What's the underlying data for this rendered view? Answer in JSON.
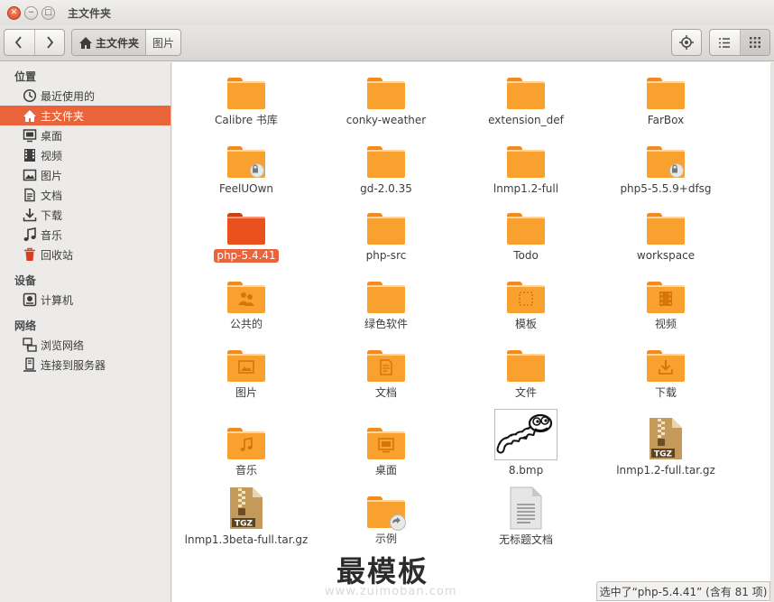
{
  "window": {
    "title": "主文件夹"
  },
  "breadcrumbs": [
    "主文件夹",
    "图片"
  ],
  "sidebar": {
    "sections": [
      {
        "title": "位置",
        "items": [
          {
            "label": "最近使用的",
            "icon": "clock-icon"
          },
          {
            "label": "主文件夹",
            "icon": "home-icon",
            "selected": true
          },
          {
            "label": "桌面",
            "icon": "desktop-icon"
          },
          {
            "label": "视频",
            "icon": "video-icon"
          },
          {
            "label": "图片",
            "icon": "picture-icon"
          },
          {
            "label": "文档",
            "icon": "document-icon"
          },
          {
            "label": "下载",
            "icon": "download-icon"
          },
          {
            "label": "音乐",
            "icon": "music-icon"
          },
          {
            "label": "回收站",
            "icon": "trash-icon"
          }
        ]
      },
      {
        "title": "设备",
        "items": [
          {
            "label": "计算机",
            "icon": "computer-icon"
          }
        ]
      },
      {
        "title": "网络",
        "items": [
          {
            "label": "浏览网络",
            "icon": "network-icon"
          },
          {
            "label": "连接到服务器",
            "icon": "server-icon"
          }
        ]
      }
    ]
  },
  "files": [
    {
      "name": "Calibre 书库",
      "type": "folder"
    },
    {
      "name": "conky-weather",
      "type": "folder"
    },
    {
      "name": "extension_def",
      "type": "folder"
    },
    {
      "name": "FarBox",
      "type": "folder"
    },
    {
      "name": "FeelUOwn",
      "type": "folder",
      "locked": true
    },
    {
      "name": "gd-2.0.35",
      "type": "folder"
    },
    {
      "name": "lnmp1.2-full",
      "type": "folder"
    },
    {
      "name": "php5-5.5.9+dfsg",
      "type": "folder",
      "locked": true
    },
    {
      "name": "php-5.4.41",
      "type": "folder",
      "selected": true
    },
    {
      "name": "php-src",
      "type": "folder"
    },
    {
      "name": "Todo",
      "type": "folder"
    },
    {
      "name": "workspace",
      "type": "folder"
    },
    {
      "name": "公共的",
      "type": "folder",
      "emblem": "people"
    },
    {
      "name": "绿色软件",
      "type": "folder"
    },
    {
      "name": "模板",
      "type": "folder",
      "emblem": "template"
    },
    {
      "name": "视频",
      "type": "folder",
      "emblem": "video"
    },
    {
      "name": "图片",
      "type": "folder",
      "emblem": "picture"
    },
    {
      "name": "文档",
      "type": "folder",
      "emblem": "document"
    },
    {
      "name": "文件",
      "type": "folder"
    },
    {
      "name": "下载",
      "type": "folder",
      "emblem": "download"
    },
    {
      "name": "音乐",
      "type": "folder",
      "emblem": "music"
    },
    {
      "name": "桌面",
      "type": "folder",
      "emblem": "desktop"
    },
    {
      "name": "8.bmp",
      "type": "image"
    },
    {
      "name": "lnmp1.2-full.tar.gz",
      "type": "archive",
      "badge": "TGZ"
    },
    {
      "name": "lnmp1.3beta-full.tar.gz",
      "type": "archive",
      "badge": "TGZ"
    },
    {
      "name": "示例",
      "type": "folder",
      "emblem": "link"
    },
    {
      "name": "无标题文档",
      "type": "text"
    }
  ],
  "status": {
    "text": "选中了“php-5.4.41” (含有 81 项)"
  },
  "watermark": {
    "text": "最模板",
    "url": "www.zuimoban.com"
  },
  "colors": {
    "accent": "#e9643b",
    "folder": "#f9a12e",
    "folder_tab": "#f38a1b",
    "folder_selected": "#e9501c"
  }
}
